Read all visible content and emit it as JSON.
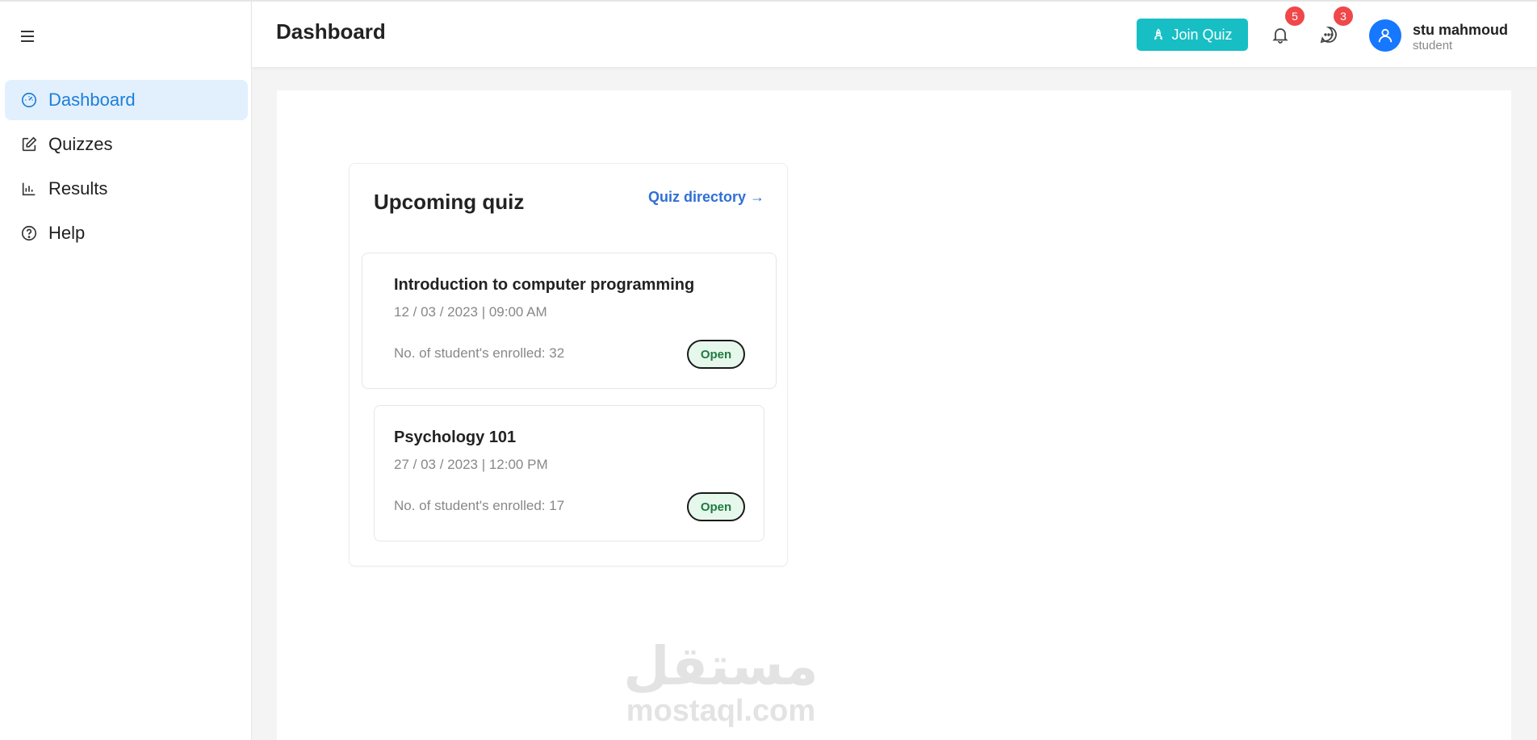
{
  "sidebar": {
    "menu_icon": "hamburger-icon",
    "items": [
      {
        "label": "Dashboard",
        "icon": "dashboard-icon",
        "active": true
      },
      {
        "label": "Quizzes",
        "icon": "edit-icon",
        "active": false
      },
      {
        "label": "Results",
        "icon": "bar-chart-icon",
        "active": false
      },
      {
        "label": "Help",
        "icon": "help-icon",
        "active": false
      }
    ]
  },
  "header": {
    "title": "Dashboard",
    "join_button": "Join Quiz",
    "notifications_count": "5",
    "messages_count": "3",
    "user": {
      "name": "stu mahmoud",
      "role": "student"
    }
  },
  "main": {
    "card_title": "Upcoming quiz",
    "directory_link": "Quiz directory →",
    "quizzes": [
      {
        "name": "Introduction to computer programming",
        "date": "12 / 03 / 2023 | 09:00 AM",
        "enrolled": "No. of student's enrolled: 32",
        "status": "Open"
      },
      {
        "name": "Psychology 101",
        "date": "27 / 03 / 2023 | 12:00 PM",
        "enrolled": "No. of student's enrolled: 17",
        "status": "Open"
      }
    ]
  },
  "watermark": {
    "arabic": "مستقل",
    "latin": "mostaql.com"
  },
  "colors": {
    "accent": "#1e7ed8",
    "active_bg": "#e2f0fd",
    "join_button": "#17bfc4",
    "badge": "#f0474b",
    "avatar": "#1677ff",
    "link": "#2f6fd6",
    "status_bg": "#e6f7ec"
  }
}
